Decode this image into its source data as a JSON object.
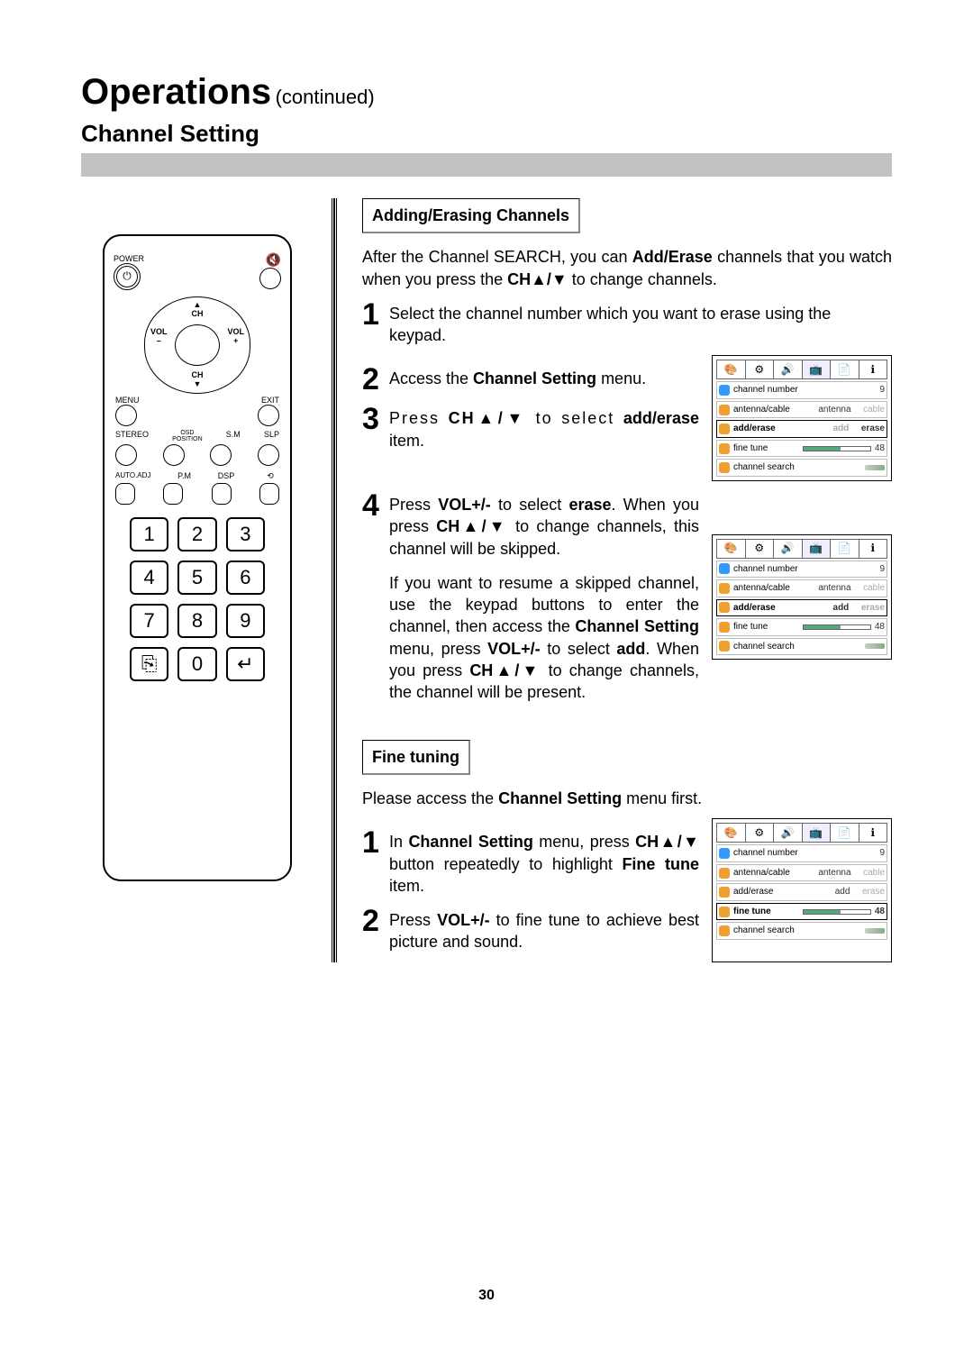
{
  "header": {
    "title": "Operations",
    "subtitle": "(continued)",
    "section": "Channel Setting"
  },
  "addErase": {
    "heading": "Adding/Erasing Channels",
    "intro_1": "After the Channel SEARCH, you can ",
    "intro_bold1": "Add/Erase",
    "intro_2": " channels that you watch when you press the ",
    "intro_bold2": "CH▲/▼",
    "intro_3": " to change channels.",
    "step1": "Select the channel number which you want to erase using the keypad.",
    "step2_a": "Access the ",
    "step2_b": "Channel Setting",
    "step2_c": " menu.",
    "step3_a": "Press ",
    "step3_b": "CH▲/▼",
    "step3_c": " to select ",
    "step3_d": "add/erase",
    "step3_e": " item.",
    "step4_a": "Press ",
    "step4_b": "VOL+/-",
    "step4_c": " to select ",
    "step4_d": "erase",
    "step4_e": ". When you press ",
    "step4_f": "CH▲/▼",
    "step4_g": " to change channels, this channel will be skipped.",
    "resume_1": "If you want to resume a skipped channel, use the keypad buttons to enter the channel, then access the ",
    "resume_b1": "Channel Setting",
    "resume_2": " menu, press ",
    "resume_b2": "VOL+/-",
    "resume_3": " to select ",
    "resume_b3": "add",
    "resume_4": ". When you press ",
    "resume_b4": "CH▲/▼",
    "resume_5": " to change channels, the channel will be present."
  },
  "fineTune": {
    "heading": "Fine tuning",
    "intro_a": "Please access the ",
    "intro_b": "Channel Setting",
    "intro_c": " menu first.",
    "step1_a": "In ",
    "step1_b": "Channel Setting",
    "step1_c": " menu, press ",
    "step1_d": "CH▲/▼",
    "step1_e": " button repeatedly to highlight ",
    "step1_f": "Fine tune",
    "step1_g": " item.",
    "step2_a": "Press ",
    "step2_b": "VOL+/-",
    "step2_c": " to fine tune to achieve best picture and sound."
  },
  "remote": {
    "power": "POWER",
    "ch": "CH",
    "vol_minus": "VOL\n–",
    "vol_plus": "VOL\n+",
    "menu": "MENU",
    "exit": "EXIT",
    "row2": [
      "STEREO",
      "OSD\nPOSITION",
      "S.M",
      "SLP"
    ],
    "row3": [
      "AUTO.ADJ",
      "P.M",
      "DSP",
      ""
    ],
    "keys": [
      "1",
      "2",
      "3",
      "4",
      "5",
      "6",
      "7",
      "8",
      "9",
      "⎘",
      "0",
      "↵"
    ]
  },
  "osd": {
    "tabs": [
      "🎨",
      "⚙",
      "🔊",
      "📺",
      "📄",
      "ℹ"
    ],
    "rows": {
      "channel_number": {
        "label": "channel number",
        "value": "9"
      },
      "antenna_cable": {
        "label": "antenna/cable",
        "v1": "antenna",
        "v2": "cable"
      },
      "add_erase": {
        "label": "add/erase",
        "v1": "add",
        "v2": "erase"
      },
      "fine_tune": {
        "label": "fine tune",
        "value": "48"
      },
      "channel_search": {
        "label": "channel search"
      }
    }
  },
  "pageNumber": "30"
}
